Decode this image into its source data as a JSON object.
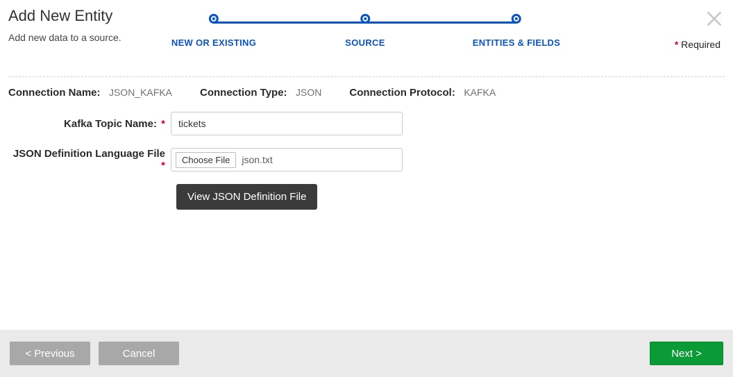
{
  "header": {
    "title": "Add New Entity",
    "subtitle": "Add new data to a source.",
    "required_label": "Required"
  },
  "stepper": {
    "steps": [
      {
        "label": "NEW OR EXISTING"
      },
      {
        "label": "SOURCE"
      },
      {
        "label": "ENTITIES & FIELDS"
      }
    ]
  },
  "connection": {
    "name_label": "Connection Name:",
    "name_value": "JSON_KAFKA",
    "type_label": "Connection Type:",
    "type_value": "JSON",
    "protocol_label": "Connection Protocol:",
    "protocol_value": "KAFKA"
  },
  "fields": {
    "topic_label": "Kafka Topic Name:",
    "topic_value": "tickets",
    "jdl_label": "JSON Definition Language File",
    "choose_file_label": "Choose File",
    "jdl_filename": "json.txt"
  },
  "buttons": {
    "view_jdl": "View JSON Definition File",
    "previous": "< Previous",
    "cancel": "Cancel",
    "next": "Next >"
  }
}
